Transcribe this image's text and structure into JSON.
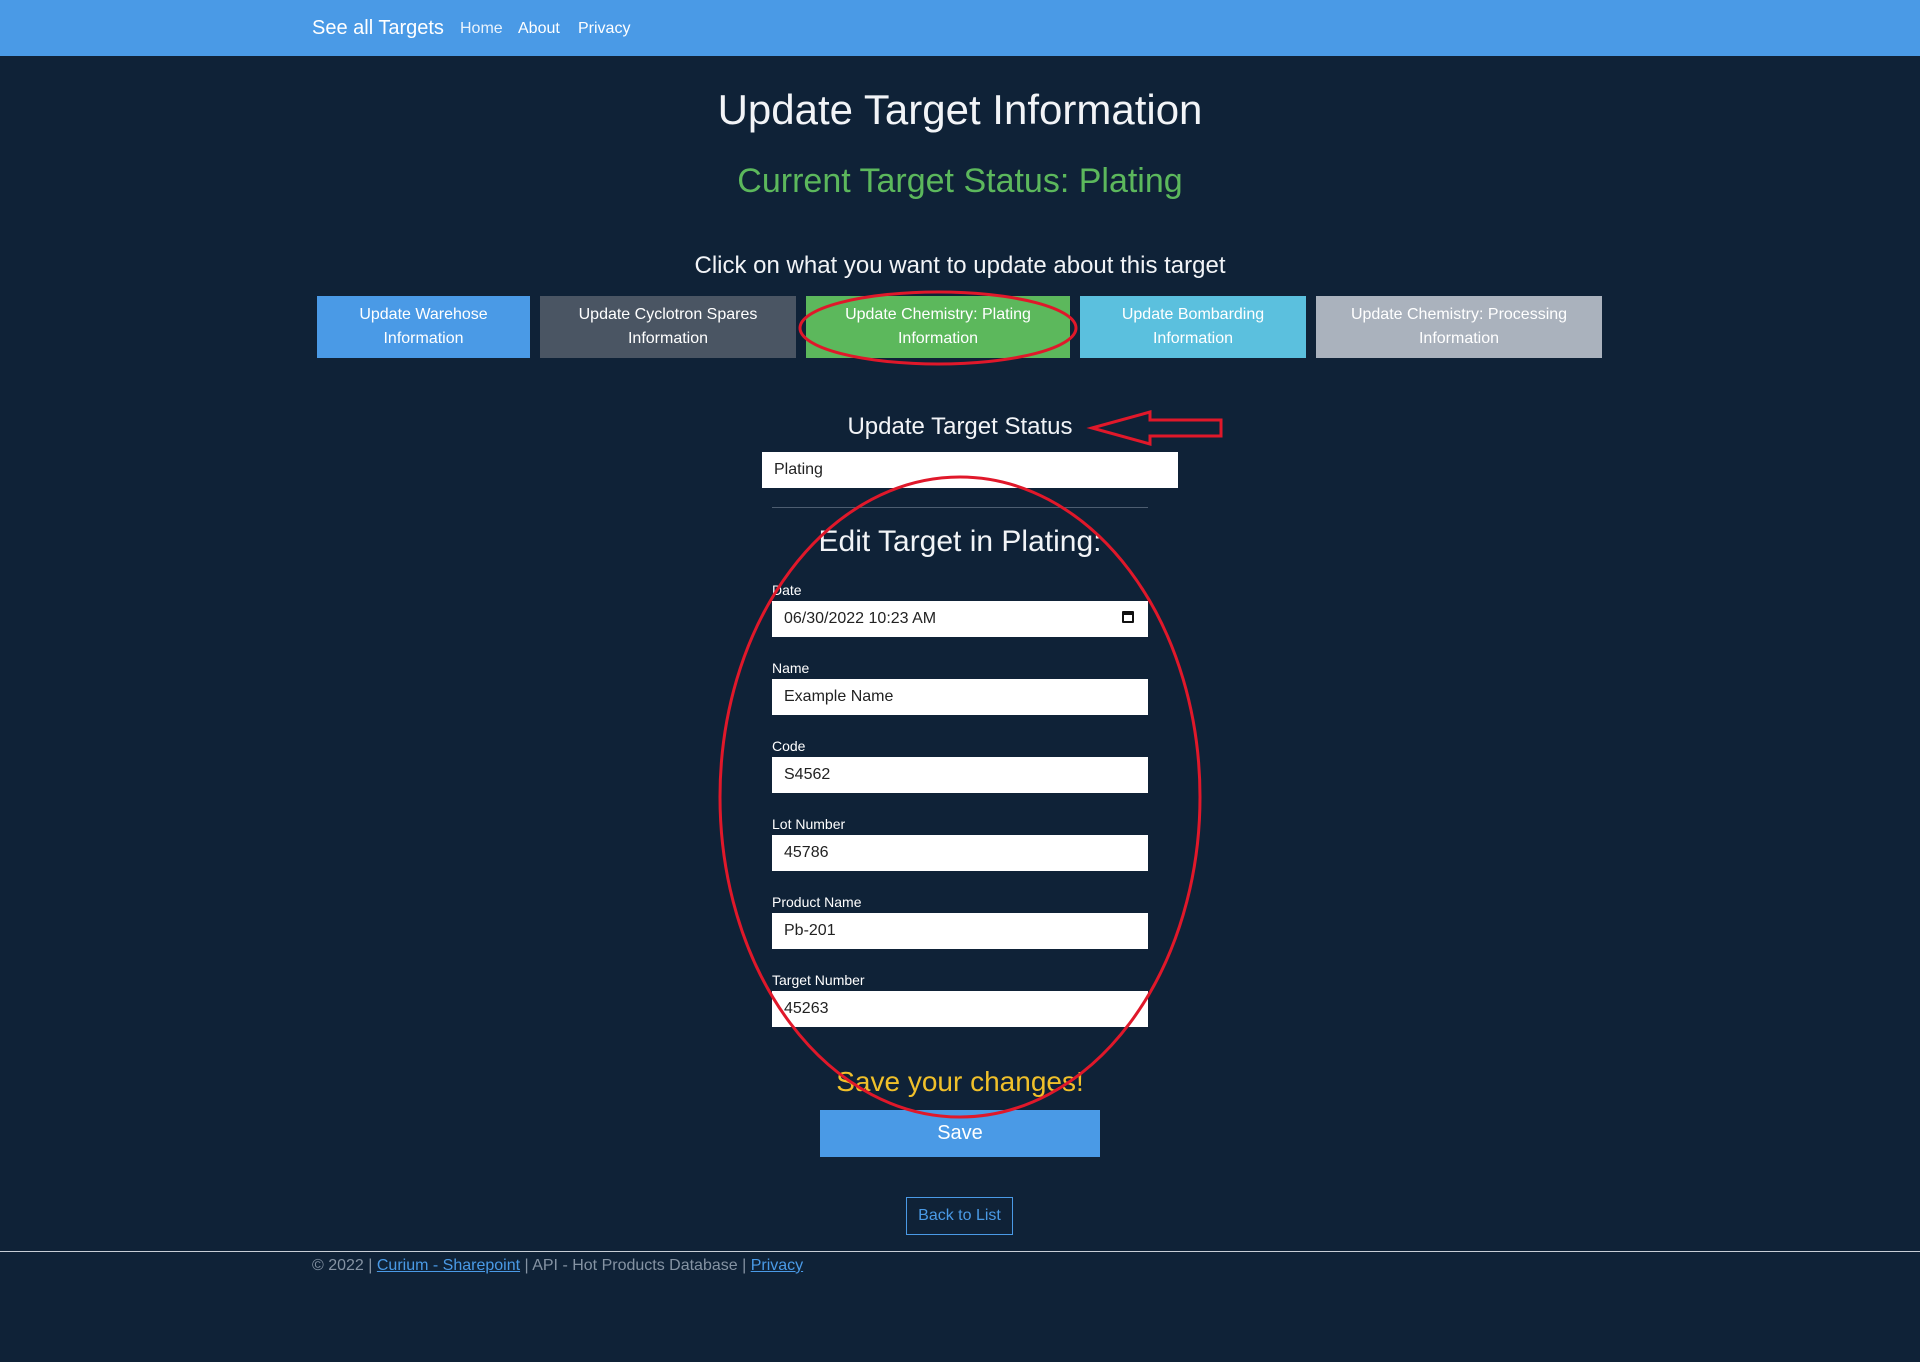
{
  "navbar": {
    "brand": "See all Targets",
    "links": [
      "Home",
      "About",
      "Privacy"
    ]
  },
  "page": {
    "title": "Update Target Information",
    "status_heading": "Current Target Status: Plating",
    "prompt": "Click on what you want to update about this target"
  },
  "sections": [
    {
      "label": "Update Warehose Information",
      "color": "#4a9ae6"
    },
    {
      "label": "Update Cyclotron Spares Information",
      "color": "#4a5563"
    },
    {
      "label": "Update Chemistry: Plating Information",
      "color": "#5cb85c"
    },
    {
      "label": "Update Bombarding Information",
      "color": "#5bc0de"
    },
    {
      "label": "Update Chemistry: Processing Information",
      "color": "#aab2bd"
    }
  ],
  "status_form": {
    "label": "Update Target Status",
    "selected": "Plating"
  },
  "edit_form": {
    "heading": "Edit Target in Plating:",
    "fields": [
      {
        "label": "Date",
        "value": "06/30/2022 10:23 AM"
      },
      {
        "label": "Name",
        "value": "Example Name"
      },
      {
        "label": "Code",
        "value": "S4562"
      },
      {
        "label": "Lot Number",
        "value": "45786"
      },
      {
        "label": "Product Name",
        "value": "Pb-201"
      },
      {
        "label": "Target Number",
        "value": "45263"
      }
    ],
    "save_prompt": "Save your changes!",
    "save_label": "Save",
    "back_label": "Back to List"
  },
  "footer": {
    "prefix": "© 2022 | ",
    "link1": "Curium - Sharepoint",
    "middle": " | API - Hot Products Database | ",
    "link2": "Privacy"
  },
  "colors": {
    "background": "#0f2237",
    "navbar": "#4a9ae6",
    "status_text": "#5cb85c",
    "save_prompt": "#f0c02a",
    "annotation": "#e0182a"
  }
}
